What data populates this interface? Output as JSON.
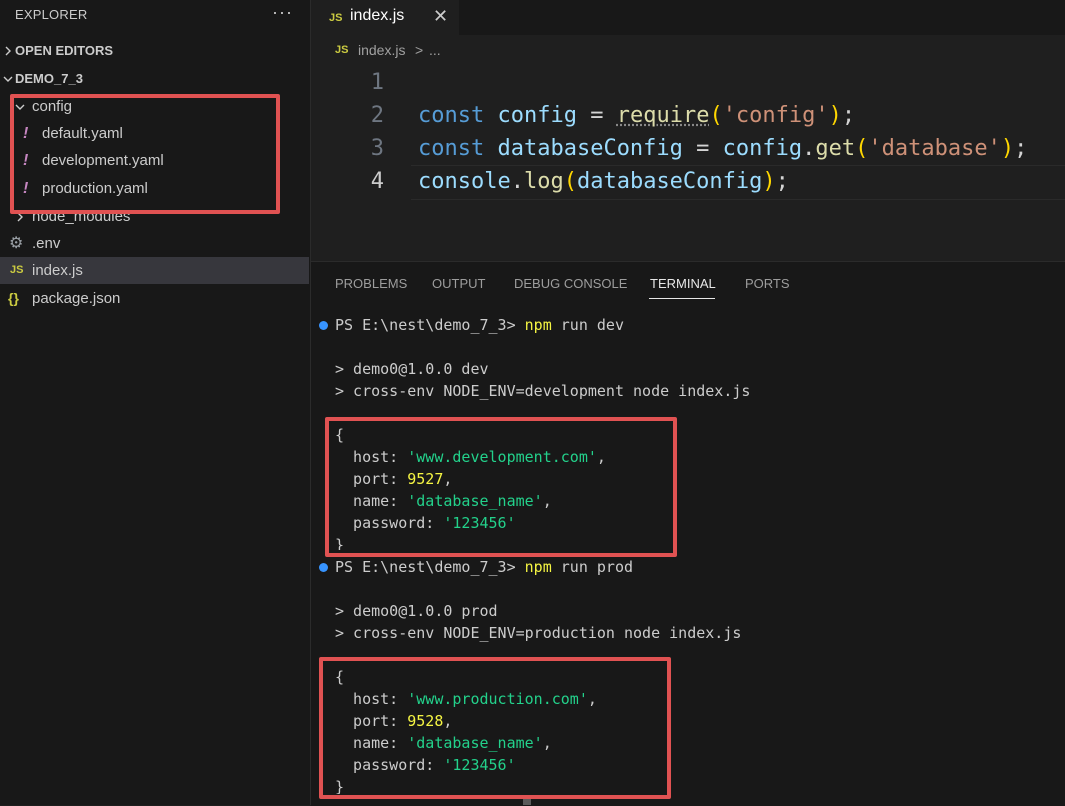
{
  "sidebar": {
    "title": "EXPLORER",
    "more": "···",
    "open_editors": "OPEN EDITORS",
    "project": "DEMO_7_3",
    "folder": "config",
    "config_files": [
      "default.yaml",
      "development.yaml",
      "production.yaml"
    ],
    "yaml_icon": "!",
    "items": {
      "node_modules": "node_modules",
      "env": ".env",
      "index": "index.js",
      "package": "package.json"
    },
    "js_icon": "JS",
    "json_icon": "{}"
  },
  "tab": {
    "label": "index.js",
    "close": "✕"
  },
  "breadcrumb": {
    "file": "index.js",
    "sep": ">",
    "more": "..."
  },
  "editor": {
    "line_numbers": [
      "1",
      "2",
      "3",
      "4"
    ]
  },
  "panel": {
    "tabs": [
      "PROBLEMS",
      "OUTPUT",
      "DEBUG CONSOLE",
      "TERMINAL",
      "PORTS"
    ],
    "active_tab": "TERMINAL"
  },
  "terminal": {
    "prompt": "PS E:\\nest\\demo_7_3>",
    "run1": {
      "cmd": "npm",
      "args": "run dev",
      "line1": "> demo0@1.0.0 dev",
      "line2": "> cross-env NODE_ENV=development node index.js",
      "open": "{",
      "host_key": "  host: ",
      "host_val": "'www.development.com'",
      "port_key": "  port: ",
      "port_val": "9527",
      "name_key": "  name: ",
      "name_val": "'database_name'",
      "pwd_key": "  password: ",
      "pwd_val": "'123456'",
      "close": "}"
    },
    "run2": {
      "cmd": "npm",
      "args": "run prod",
      "line1": "> demo0@1.0.0 prod",
      "line2": "> cross-env NODE_ENV=production node index.js",
      "open": "{",
      "host_key": "  host: ",
      "host_val": "'www.production.com'",
      "port_key": "  port: ",
      "port_val": "9528",
      "name_key": "  name: ",
      "name_val": "'database_name'",
      "pwd_key": "  password: ",
      "pwd_val": "'123456'",
      "close": "}"
    },
    "comma": ","
  },
  "colors": {
    "highlight_box": "#e05252",
    "terminal_string": "#23d18b",
    "terminal_number": "#f5f543"
  }
}
